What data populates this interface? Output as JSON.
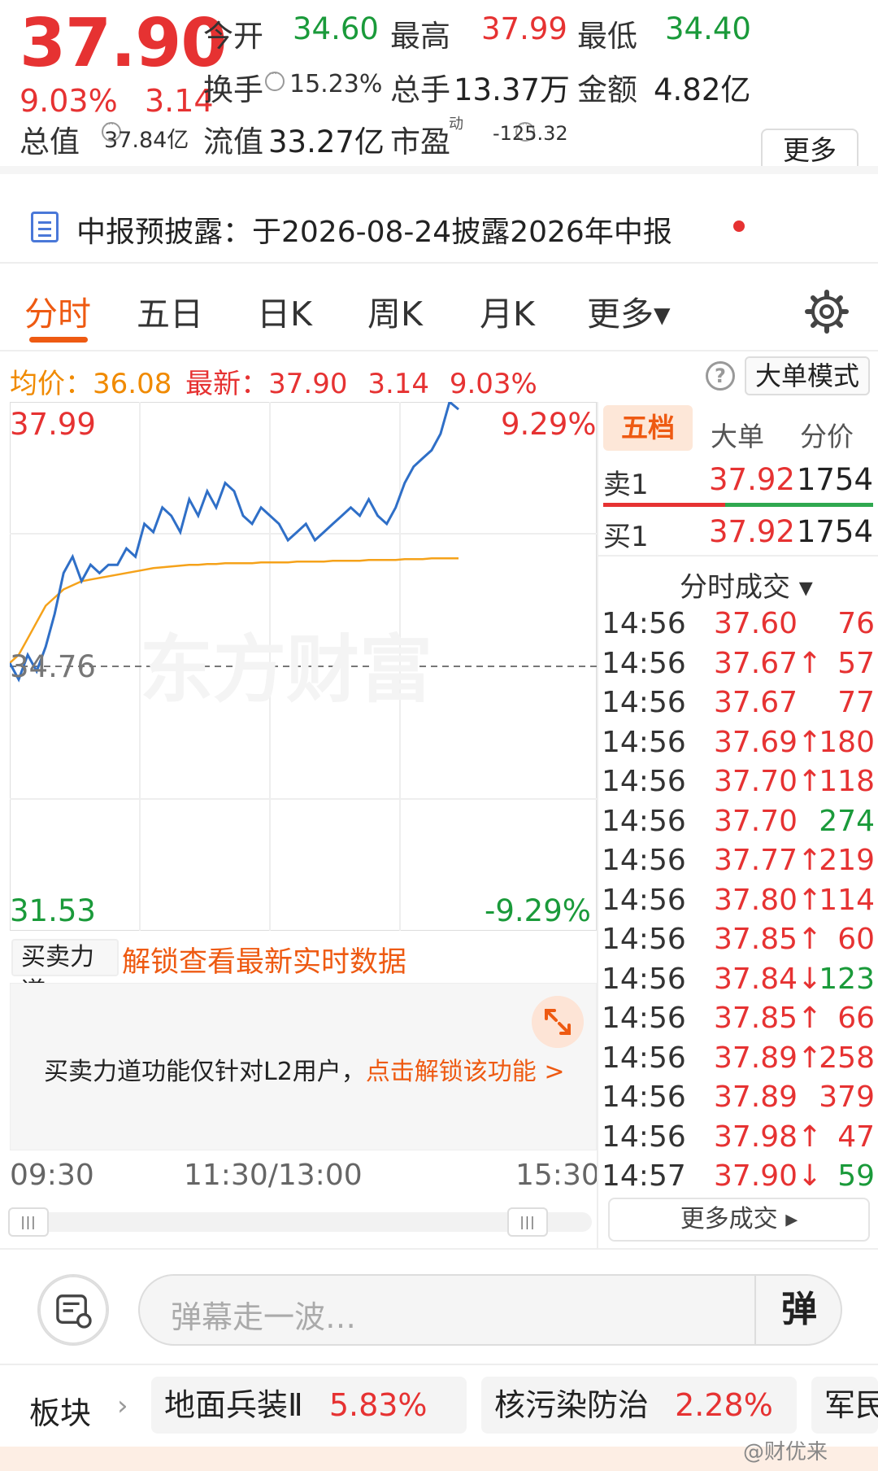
{
  "quote": {
    "price": "37.90",
    "pct": "9.03%",
    "change": "3.14",
    "open_label": "今开",
    "open": "34.60",
    "high_label": "最高",
    "high": "37.99",
    "low_label": "最低",
    "low": "34.40",
    "turnover_label": "换手",
    "turnover": "15.23%",
    "volume_label": "总手",
    "volume": "13.37万",
    "amount_label": "金额",
    "amount": "4.82亿",
    "mktcap_label": "总值",
    "mktcap": "37.84亿",
    "float_label": "流值",
    "float": "33.27亿",
    "pe_label": "市盈",
    "pe_sup": "动",
    "pe": "-125.32",
    "more": "更多"
  },
  "notice": {
    "text": "中报预披露：于2026-08-24披露2026年中报"
  },
  "tabs": [
    {
      "label": "分时"
    },
    {
      "label": "五日"
    },
    {
      "label": "日K"
    },
    {
      "label": "周K"
    },
    {
      "label": "月K"
    },
    {
      "label": "更多▾"
    }
  ],
  "avgbar": {
    "avg_label": "均价：",
    "avg": "36.08",
    "latest_label": "最新：",
    "latest": "37.90",
    "change": "3.14",
    "pct": "9.03%",
    "help": "?",
    "bigorder": "大单模式"
  },
  "chart_axes": {
    "y_max": "37.99",
    "y_min": "31.53",
    "y_mid": "34.76",
    "pct_max": "9.29%",
    "pct_min": "-9.29%",
    "watermark": "东方财富",
    "t_start": "09:30",
    "t_mid": "11:30/13:00",
    "t_end": "15:30"
  },
  "chart_data": {
    "type": "line",
    "ylim": [
      31.53,
      37.99
    ],
    "series": [
      {
        "values": [
          34.8,
          34.6,
          34.9,
          34.7,
          35.0,
          35.4,
          35.9,
          36.1,
          35.8,
          36.0,
          35.9,
          36.0,
          36.0,
          36.2,
          36.1,
          36.5,
          36.4,
          36.7,
          36.6,
          36.4,
          36.8,
          36.6,
          36.9,
          36.7,
          37.0,
          36.9,
          36.6,
          36.5,
          36.7,
          36.6,
          36.5,
          36.3,
          36.4,
          36.5,
          36.3,
          36.4,
          36.5,
          36.6,
          36.7,
          36.6,
          36.8,
          36.6,
          36.5,
          36.7,
          37.0,
          37.2,
          37.3,
          37.4,
          37.6,
          37.99,
          37.9
        ]
      },
      {
        "values": [
          34.8,
          34.9,
          35.1,
          35.3,
          35.5,
          35.6,
          35.7,
          35.75,
          35.8,
          35.82,
          35.84,
          35.86,
          35.88,
          35.9,
          35.92,
          35.94,
          35.96,
          35.97,
          35.98,
          35.99,
          36.0,
          36.0,
          36.01,
          36.01,
          36.02,
          36.02,
          36.02,
          36.02,
          36.03,
          36.03,
          36.03,
          36.03,
          36.04,
          36.04,
          36.04,
          36.04,
          36.05,
          36.05,
          36.05,
          36.05,
          36.06,
          36.06,
          36.06,
          36.06,
          36.07,
          36.07,
          36.07,
          36.08,
          36.08,
          36.08,
          36.08
        ]
      }
    ]
  },
  "rightpanel": {
    "tabs": [
      "五档",
      "大单",
      "分价"
    ],
    "ask": {
      "label": "卖1",
      "price": "37.92",
      "vol": "1754"
    },
    "bid": {
      "label": "买1",
      "price": "37.92",
      "vol": "1754"
    },
    "trades_header": "分时成交 ▾",
    "trades": [
      {
        "t": "14:56",
        "p": "37.60",
        "v": "76",
        "c": "red"
      },
      {
        "t": "14:56",
        "p": "37.67↑",
        "v": "57",
        "c": "red"
      },
      {
        "t": "14:56",
        "p": "37.67",
        "v": "77",
        "c": "red"
      },
      {
        "t": "14:56",
        "p": "37.69↑",
        "v": "180",
        "c": "red"
      },
      {
        "t": "14:56",
        "p": "37.70↑",
        "v": "118",
        "c": "red"
      },
      {
        "t": "14:56",
        "p": "37.70",
        "v": "274",
        "c": "green"
      },
      {
        "t": "14:56",
        "p": "37.77↑",
        "v": "219",
        "c": "red"
      },
      {
        "t": "14:56",
        "p": "37.80↑",
        "v": "114",
        "c": "red"
      },
      {
        "t": "14:56",
        "p": "37.85↑",
        "v": "60",
        "c": "red"
      },
      {
        "t": "14:56",
        "p": "37.84↓",
        "v": "123",
        "c": "green"
      },
      {
        "t": "14:56",
        "p": "37.85↑",
        "v": "66",
        "c": "red"
      },
      {
        "t": "14:56",
        "p": "37.89↑",
        "v": "258",
        "c": "red"
      },
      {
        "t": "14:56",
        "p": "37.89",
        "v": "379",
        "c": "red"
      },
      {
        "t": "14:56",
        "p": "37.98↑",
        "v": "47",
        "c": "red"
      },
      {
        "t": "14:57",
        "p": "37.90↓",
        "v": "59",
        "c": "green"
      }
    ],
    "more_trades": "更多成交 ▸"
  },
  "buysell": {
    "select": "买卖力道 ▾",
    "unlock": "解锁查看最新实时数据",
    "msg": "买卖力道功能仅针对L2用户，",
    "msg_link": "点击解锁该功能 >"
  },
  "danmaku": {
    "placeholder": "弹幕走一波…",
    "btn": "弹"
  },
  "sectors": {
    "label": "板块",
    "items": [
      {
        "name": "地面兵装Ⅱ",
        "pct": "5.83%"
      },
      {
        "name": "核污染防治",
        "pct": "2.28%"
      },
      {
        "name": "军民",
        "pct": ""
      }
    ]
  },
  "watermark": "@财优来"
}
